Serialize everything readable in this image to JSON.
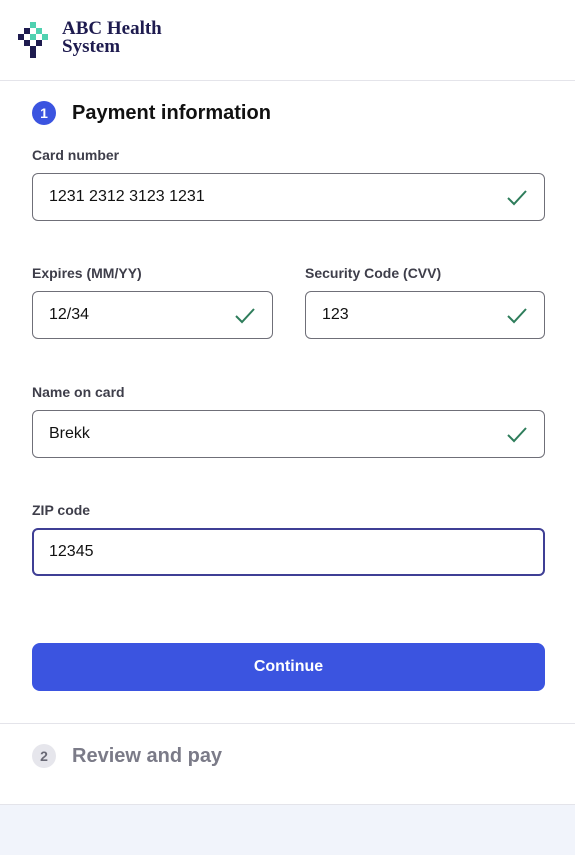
{
  "header": {
    "logo_line1": "ABC Health",
    "logo_line2": "System",
    "logo_icon": "cross-logo-icon"
  },
  "step1": {
    "number": "1",
    "title": "Payment information"
  },
  "form": {
    "card_number": {
      "label": "Card number",
      "value": "1231 2312 3123 1231",
      "valid": true
    },
    "expires": {
      "label": "Expires (MM/YY)",
      "value": "12/34",
      "valid": true
    },
    "cvv": {
      "label": "Security Code (CVV)",
      "value": "123",
      "valid": true
    },
    "name": {
      "label": "Name on card",
      "value": "Brekk",
      "valid": true
    },
    "zip": {
      "label": "ZIP code",
      "value": "12345",
      "focused": true
    }
  },
  "continue_label": "Continue",
  "step2": {
    "number": "2",
    "title": "Review and pay"
  },
  "colors": {
    "accent": "#3b54e0",
    "check": "#2e7d5b",
    "logo_navy": "#1e1b4f",
    "logo_teal": "#4fd1b0",
    "muted": "#7b7b88"
  }
}
